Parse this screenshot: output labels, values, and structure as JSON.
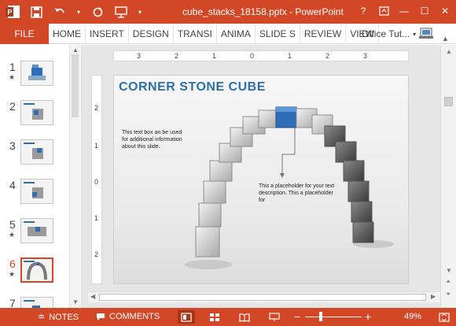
{
  "window": {
    "title": "cube_stacks_18158.pptx - PowerPoint",
    "help": "?",
    "minimize": "—",
    "maximize": "☐",
    "close": "✕"
  },
  "ribbon": {
    "file": "FILE",
    "tabs": [
      "HOME",
      "INSERT",
      "DESIGN",
      "TRANSI",
      "ANIMA",
      "SLIDE S",
      "REVIEW",
      "VIEW"
    ],
    "account": "Office Tut..."
  },
  "thumbnails": [
    {
      "num": "1",
      "star": "★"
    },
    {
      "num": "2",
      "star": ""
    },
    {
      "num": "3",
      "star": ""
    },
    {
      "num": "4",
      "star": ""
    },
    {
      "num": "5",
      "star": "★"
    },
    {
      "num": "6",
      "star": "★",
      "active": true
    },
    {
      "num": "7",
      "star": ""
    }
  ],
  "rulers": {
    "horizontal": [
      "3",
      "2",
      "1",
      "0",
      "1",
      "2",
      "3"
    ],
    "vertical": [
      "2",
      "1",
      "0",
      "1",
      "2"
    ]
  },
  "slide": {
    "title": "CORNER STONE CUBE",
    "note_left": "This text box an be used for additional information about this slide.",
    "note_right": "This a placeholder for your text description. This a placeholder for"
  },
  "status": {
    "notes": "NOTES",
    "comments": "COMMENTS",
    "zoom": "49%",
    "zoom_minus": "−",
    "zoom_plus": "+"
  },
  "colors": {
    "accent": "#d24726",
    "title_blue": "#2d6fa9",
    "keystone": "#2e6eb8"
  }
}
